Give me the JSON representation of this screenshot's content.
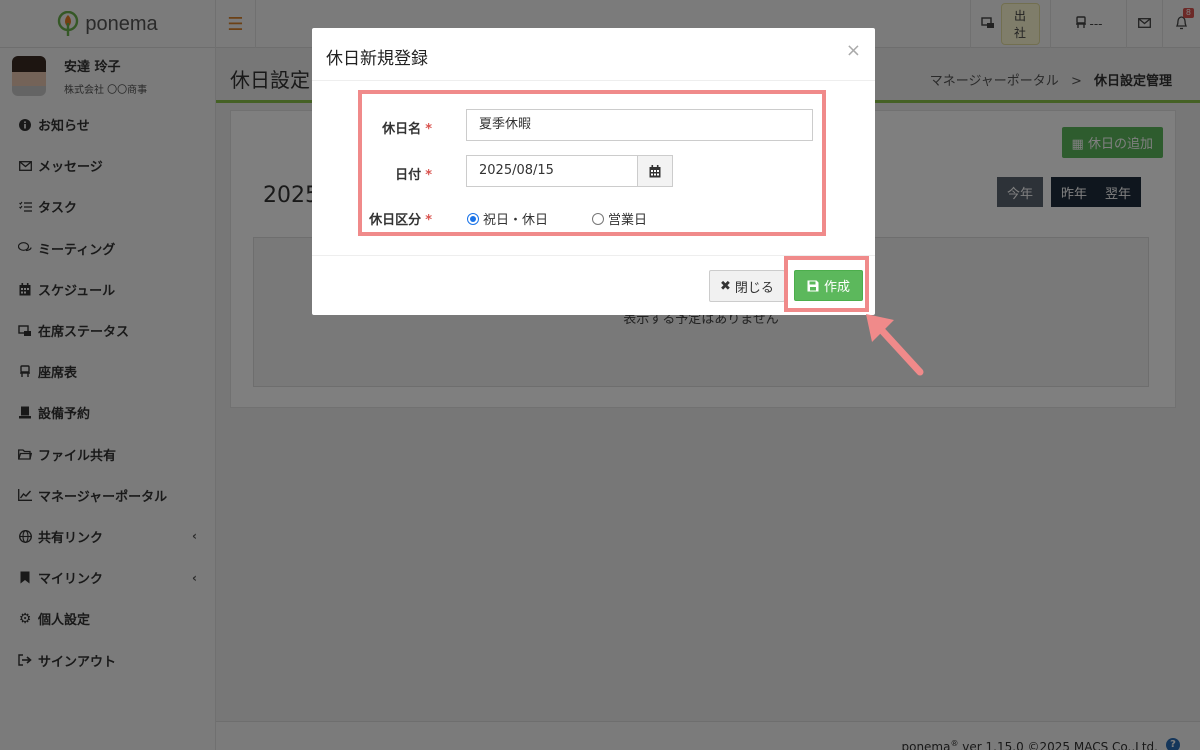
{
  "app": {
    "logo_text": "ponema"
  },
  "topbar": {
    "attendance_label": "出社",
    "seat_label": "---",
    "notification_count": "8"
  },
  "user": {
    "name": "安達 玲子",
    "company": "株式会社 〇〇商事"
  },
  "sidebar": {
    "items": [
      {
        "label": "お知らせ",
        "icon": "info-circle-icon"
      },
      {
        "label": "メッセージ",
        "icon": "envelope-icon"
      },
      {
        "label": "タスク",
        "icon": "task-list-icon"
      },
      {
        "label": "ミーティング",
        "icon": "chat-bubbles-icon"
      },
      {
        "label": "スケジュール",
        "icon": "calendar-icon"
      },
      {
        "label": "在席ステータス",
        "icon": "presence-icon"
      },
      {
        "label": "座席表",
        "icon": "seat-icon"
      },
      {
        "label": "設備予約",
        "icon": "facility-icon"
      },
      {
        "label": "ファイル共有",
        "icon": "folder-icon"
      },
      {
        "label": "マネージャーポータル",
        "icon": "line-chart-icon"
      },
      {
        "label": "共有リンク",
        "icon": "globe-icon"
      },
      {
        "label": "マイリンク",
        "icon": "bookmark-icon"
      },
      {
        "label": "個人設定",
        "icon": "gear-icon"
      },
      {
        "label": "サインアウト",
        "icon": "sign-out-icon"
      }
    ]
  },
  "page": {
    "title": "休日設定",
    "breadcrumb_parent": "マネージャーポータル",
    "breadcrumb_separator": ">",
    "breadcrumb_current": "休日設定管理",
    "add_button_label": "休日の追加",
    "year_label": "2025",
    "this_year_label": "今年",
    "prev_year_label": "昨年",
    "next_year_label": "翌年",
    "empty_text": "表示する予定はありません"
  },
  "modal": {
    "title": "休日新規登録",
    "name_label": "休日名",
    "name_value": "夏季休暇",
    "date_label": "日付",
    "date_value": "2025/08/15",
    "type_label": "休日区分",
    "required_mark": "*",
    "option_holiday": "祝日・休日",
    "option_business": "営業日",
    "selected_option": "祝日・休日",
    "close_label": "閉じる",
    "create_label": "作成"
  },
  "footer": {
    "brand": "ponema",
    "registered_mark": "®",
    "version_text": " ver 1.15.0 ©2025 MACS Co.,Ltd.",
    "help_glyph": "?"
  },
  "colors": {
    "accent_green": "#5cb85c",
    "title_rule": "#8bc34a",
    "dark_button": "#1f2d3d",
    "highlight": "#f08a8a",
    "badge_red": "#d9534f"
  }
}
